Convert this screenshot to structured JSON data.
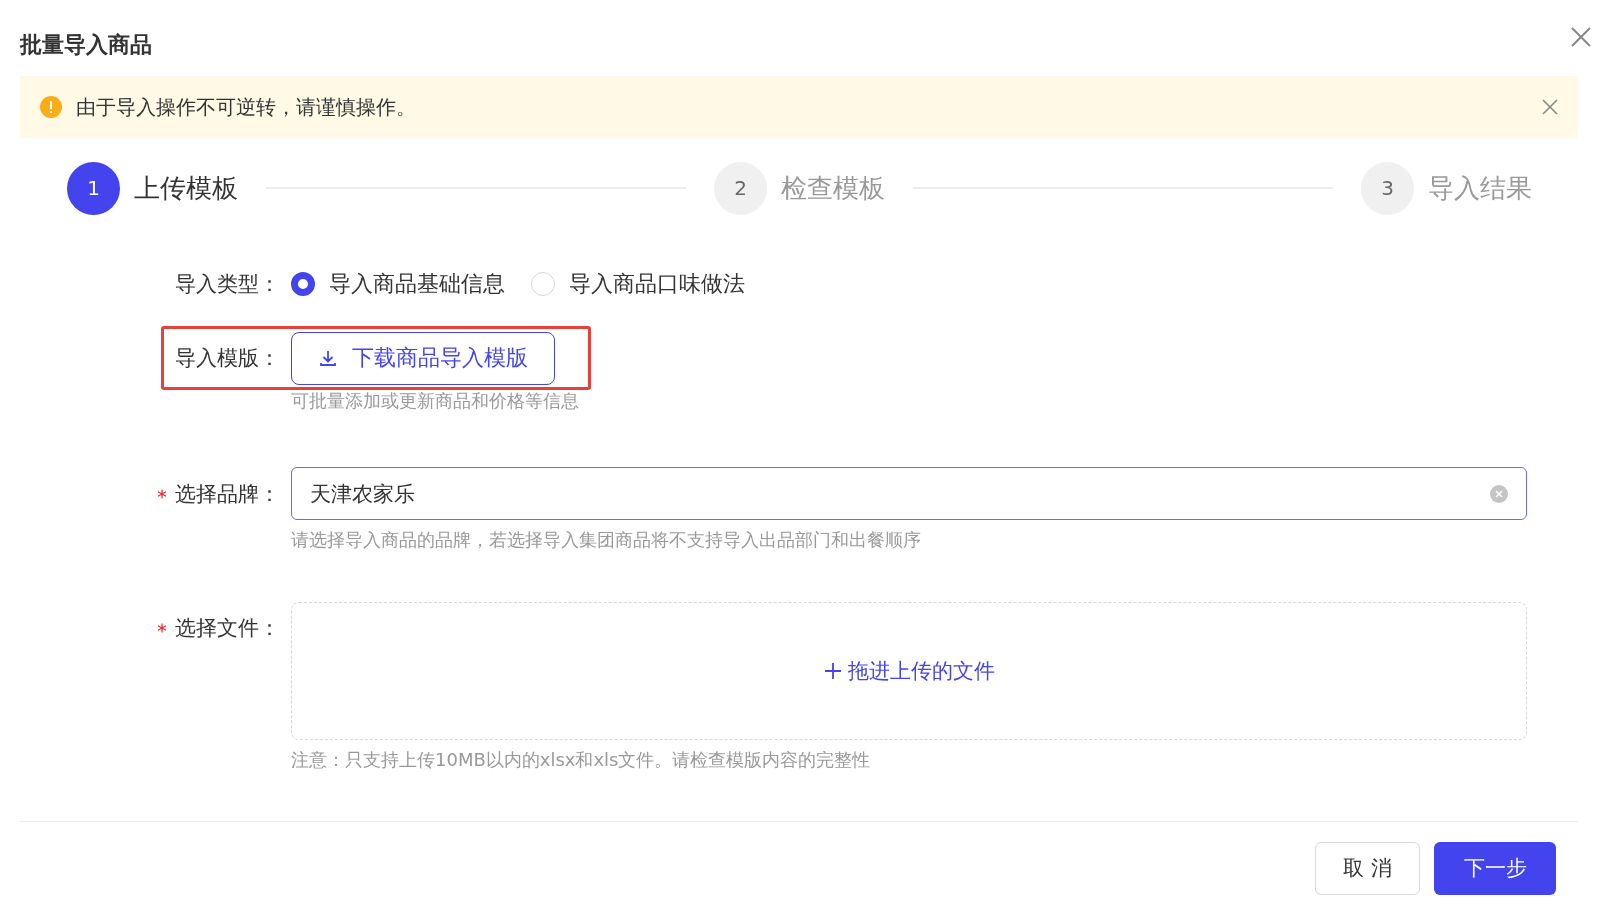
{
  "dialog": {
    "title": "批量导入商品"
  },
  "alert": {
    "text": "由于导入操作不可逆转，请谨慎操作。"
  },
  "steps": [
    {
      "number": "1",
      "label": "上传模板",
      "selected": true
    },
    {
      "number": "2",
      "label": "检查模板",
      "selected": false
    },
    {
      "number": "3",
      "label": "导入结果",
      "selected": false
    }
  ],
  "form": {
    "import_type": {
      "label": "导入类型：",
      "options": [
        {
          "label": "导入商品基础信息",
          "selected": true
        },
        {
          "label": "导入商品口味做法",
          "selected": false
        }
      ]
    },
    "template": {
      "label": "导入模版：",
      "button": "下载商品导入模版",
      "hint": "可批量添加或更新商品和价格等信息",
      "highlighted": true
    },
    "brand": {
      "label": "选择品牌：",
      "required": true,
      "value": "天津农家乐",
      "hint": "请选择导入商品的品牌，若选择导入集团商品将不支持导入出品部门和出餐顺序"
    },
    "file": {
      "label": "选择文件：",
      "required": true,
      "drop_text": "拖进上传的文件",
      "note": "注意：只支持上传10MB以内的xlsx和xls文件。请检查模版内容的完整性"
    }
  },
  "buttons": [
    {
      "label": "取 消",
      "kind": "default"
    },
    {
      "label": "下一步",
      "kind": "primary"
    }
  ]
}
